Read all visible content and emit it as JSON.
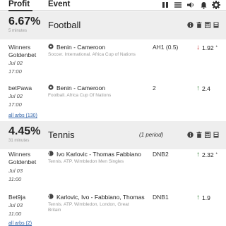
{
  "header": {
    "profit": "Profit",
    "event": "Event"
  },
  "blocks": [
    {
      "percent": "6.67%",
      "ago": "5 minutes",
      "sport": "Football",
      "period": "",
      "rows": [
        {
          "bookmaker": "Winners Goldenbet",
          "date": "Jul 02",
          "time": "17:00",
          "match": "Benin - Cameroon",
          "league": "Soccer. International. Africa Cup of Nations",
          "market": "AH1 (0.5)",
          "odds": "1.92",
          "odds_suffix": "*",
          "direction": "down"
        },
        {
          "bookmaker": "betPawa",
          "date": "Jul 02",
          "time": "17:00",
          "match": "Benin - Cameroon",
          "league": "Football. Africa Cup Of Nations",
          "market": "2",
          "odds": "2.4",
          "odds_suffix": "",
          "direction": "up"
        }
      ],
      "all_arbs": "all arbs (130)"
    },
    {
      "percent": "4.45%",
      "ago": "31 minutes",
      "sport": "Tennis",
      "period": "(1 period)",
      "rows": [
        {
          "bookmaker": "Winners Goldenbet",
          "date": "Jul 03",
          "time": "11:00",
          "match": "Ivo Karlovic - Thomas Fabbiano",
          "league": "Tennis. ATP. Wimbledon Men Singles",
          "market": "DNB2",
          "odds": "2.32",
          "odds_suffix": "*",
          "direction": "up"
        },
        {
          "bookmaker": "Bet9ja",
          "date": "Jul 03",
          "time": "11:00",
          "match": "Karlovic, Ivo - Fabbiano, Thomas",
          "league": "Tennis. ATP. Wimbledon, London, Great Britain",
          "market": "DNB1",
          "odds": "1.9",
          "odds_suffix": "",
          "direction": "up"
        }
      ],
      "all_arbs": "all arbs (2)"
    }
  ],
  "colors": {
    "up": "#2e7d32",
    "down": "#c62828",
    "link": "#2f62a8"
  },
  "icons": [
    "pause-icon",
    "filter-icon",
    "volume-icon",
    "bell-icon",
    "settings-icon"
  ]
}
